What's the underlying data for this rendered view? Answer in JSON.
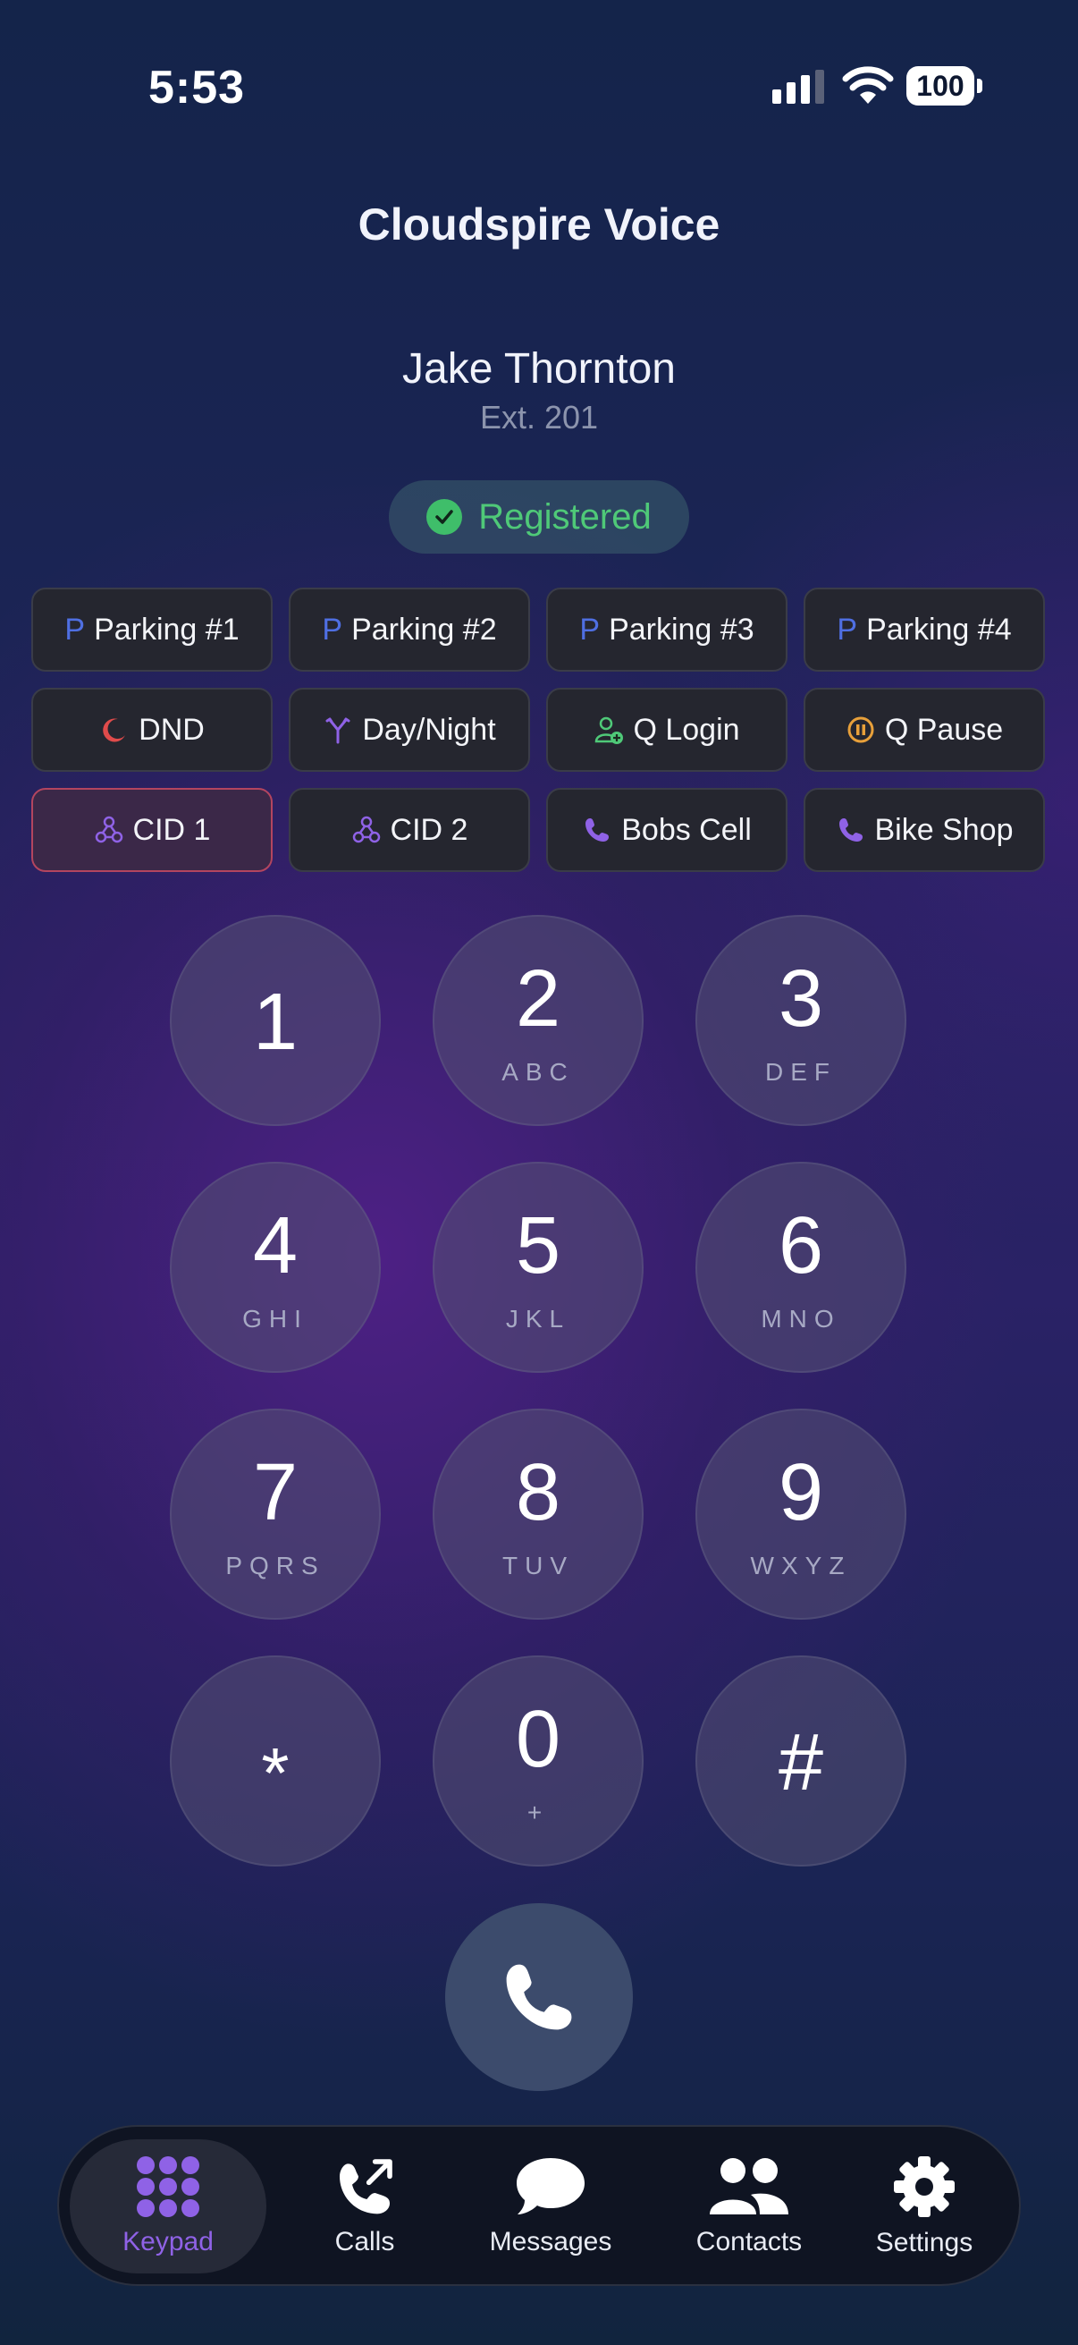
{
  "status_bar": {
    "time": "5:53",
    "battery": "100"
  },
  "header": {
    "title": "Cloudspire Voice"
  },
  "user": {
    "name": "Jake Thornton",
    "extension": "Ext. 201"
  },
  "registration": {
    "status": "Registered",
    "color": "#4fc978"
  },
  "quick_buttons": [
    {
      "label": "Parking #1",
      "icon": "parking-icon",
      "prefix": "P"
    },
    {
      "label": "Parking #2",
      "icon": "parking-icon",
      "prefix": "P"
    },
    {
      "label": "Parking #3",
      "icon": "parking-icon",
      "prefix": "P"
    },
    {
      "label": "Parking #4",
      "icon": "parking-icon",
      "prefix": "P"
    },
    {
      "label": "DND",
      "icon": "moon-icon"
    },
    {
      "label": "Day/Night",
      "icon": "split-arrow-icon"
    },
    {
      "label": "Q Login",
      "icon": "user-add-icon"
    },
    {
      "label": "Q Pause",
      "icon": "pause-circle-icon"
    },
    {
      "label": "CID 1",
      "icon": "cid-icon",
      "active": true
    },
    {
      "label": "CID 2",
      "icon": "cid-icon"
    },
    {
      "label": "Bobs Cell",
      "icon": "phone-icon"
    },
    {
      "label": "Bike Shop",
      "icon": "phone-icon"
    }
  ],
  "keypad": [
    {
      "digit": "1",
      "letters": ""
    },
    {
      "digit": "2",
      "letters": "ABC"
    },
    {
      "digit": "3",
      "letters": "DEF"
    },
    {
      "digit": "4",
      "letters": "GHI"
    },
    {
      "digit": "5",
      "letters": "JKL"
    },
    {
      "digit": "6",
      "letters": "MNO"
    },
    {
      "digit": "7",
      "letters": "PQRS"
    },
    {
      "digit": "8",
      "letters": "TUV"
    },
    {
      "digit": "9",
      "letters": "WXYZ"
    },
    {
      "digit": "*",
      "letters": ""
    },
    {
      "digit": "0",
      "letters": "+"
    },
    {
      "digit": "#",
      "letters": ""
    }
  ],
  "tabs": [
    {
      "label": "Keypad",
      "icon": "keypad-icon",
      "active": true
    },
    {
      "label": "Calls",
      "icon": "outgoing-call-icon"
    },
    {
      "label": "Messages",
      "icon": "chat-bubble-icon"
    },
    {
      "label": "Contacts",
      "icon": "people-icon"
    },
    {
      "label": "Settings",
      "icon": "gear-icon"
    }
  ],
  "colors": {
    "accent": "#8f62e6",
    "parking": "#4f6fe2",
    "dnd": "#e04b4b",
    "qlogin": "#4fc978",
    "qpause": "#e8a03a"
  }
}
